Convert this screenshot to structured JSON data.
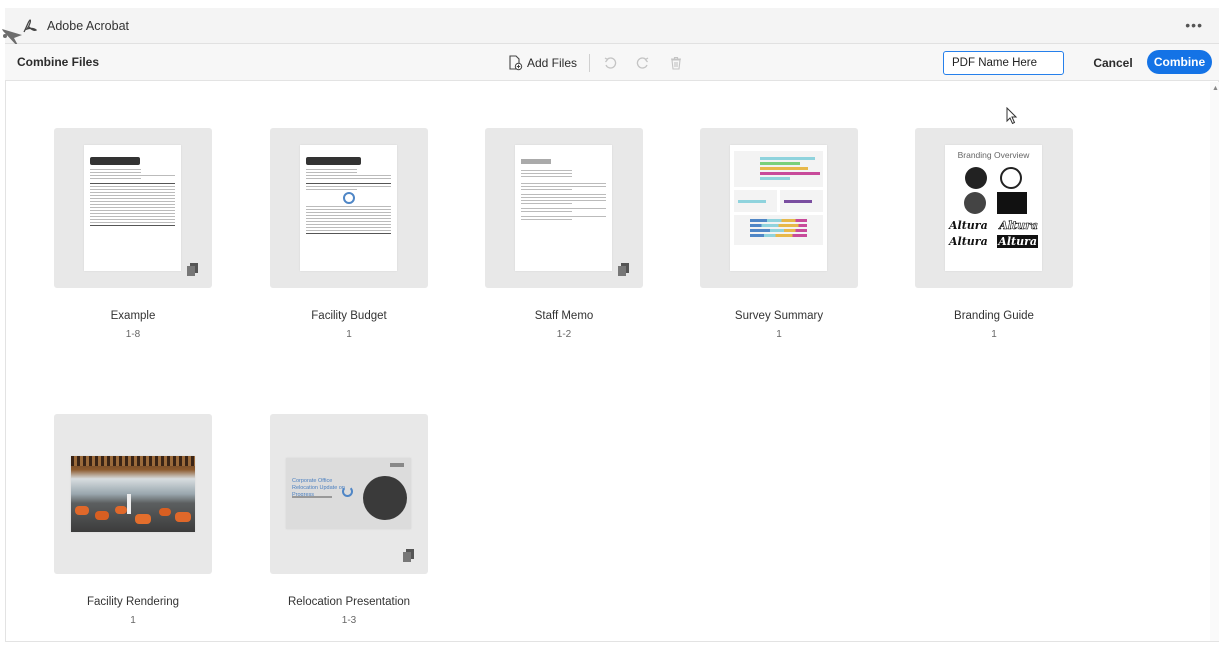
{
  "window": {
    "app_title": "Adobe Acrobat",
    "more_icon": "more-horizontal-icon"
  },
  "toolbar": {
    "section_title": "Combine Files",
    "add_files_label": "Add Files",
    "pdf_name_value": "PDF Name Here",
    "cancel_label": "Cancel",
    "combine_label": "Combine"
  },
  "colors": {
    "accent": "#1473e6",
    "toolbar_bg": "#f7f7f7",
    "tile_bg": "#e8e8e8"
  },
  "files": [
    {
      "name": "Example",
      "pages": "1-8"
    },
    {
      "name": "Facility Budget",
      "pages": "1"
    },
    {
      "name": "Staff Memo",
      "pages": "1-2"
    },
    {
      "name": "Survey Summary",
      "pages": "1"
    },
    {
      "name": "Branding Guide",
      "pages": "1"
    },
    {
      "name": "Facility Rendering",
      "pages": "1"
    },
    {
      "name": "Relocation Presentation",
      "pages": "1-3"
    }
  ],
  "thumbnails": {
    "branding_title": "Branding Overview",
    "brand_word": "Altura",
    "presentation_title": "Corporate Office Relocation Update on Progress"
  }
}
